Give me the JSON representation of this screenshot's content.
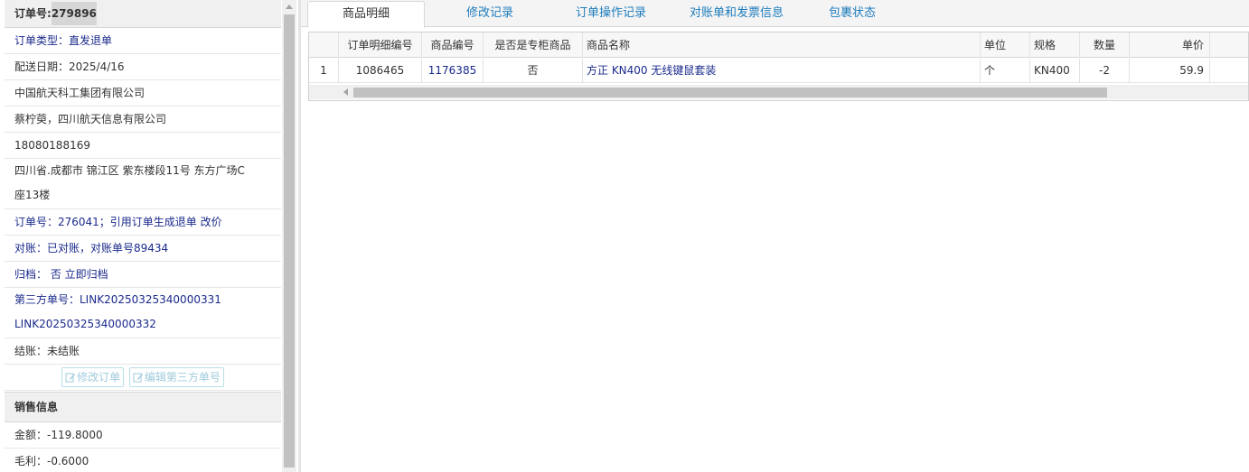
{
  "order": {
    "number_label": "订单号:",
    "number_value": "279896",
    "type": "订单类型：直发退单",
    "delivery_date": "配送日期：2025/4/16",
    "company": "中国航天科工集团有限公司",
    "contact": "蔡柠萸，四川航天信息有限公司",
    "phone": "18080188169",
    "address_line1": "四川省.成都市 锦江区 紫东楼段11号 东方广场C",
    "address_line2": "座13楼",
    "ref_order": "订单号：276041；引用订单生成退单 改价",
    "reconcile": "对账：已对账，对账单号89434",
    "archive": "归档： 否 立即归档",
    "third_party_line1": "第三方单号：LINK20250325340000331",
    "third_party_line2": "LINK20250325340000332",
    "settlement": "结账：未结账",
    "edit_order_button": "修改订单",
    "edit_third_party_button": "编辑第三方单号"
  },
  "sales": {
    "title": "销售信息",
    "amount": "金额：-119.8000",
    "gross_profit": "毛利：-0.6000"
  },
  "tabs": [
    "商品明细",
    "修改记录",
    "订单操作记录",
    "对账单和发票信息",
    "包裹状态"
  ],
  "grid": {
    "headers": [
      "订单明细编号",
      "商品编号",
      "是否是专柜商品",
      "商品名称",
      "单位",
      "规格",
      "数量",
      "单价"
    ],
    "rows": [
      {
        "index": "1",
        "detail_id": "1086465",
        "product_id": "1176385",
        "is_counter": "否",
        "name": "方正 KN400 无线键鼠套装",
        "unit": "个",
        "spec": "KN400",
        "qty": "-2",
        "price": "59.9"
      }
    ]
  },
  "icons": {
    "edit": "edit-icon",
    "scroll_up": "scroll-up-arrow-icon",
    "scroll_left": "scroll-left-arrow-icon"
  }
}
